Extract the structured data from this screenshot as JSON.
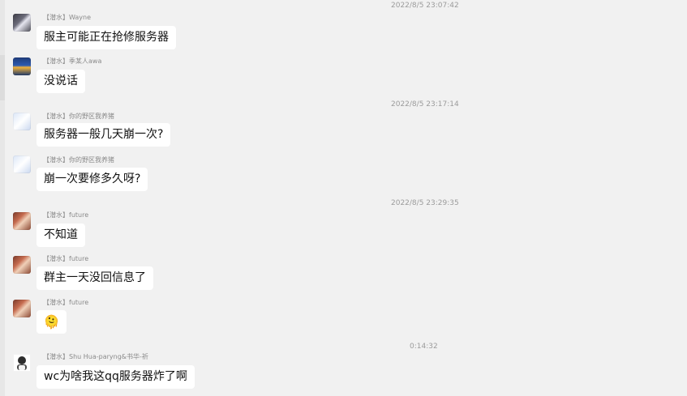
{
  "timestamps": [
    "2022/8/5 23:07:42",
    "2022/8/5 23:17:14",
    "2022/8/5 23:29:35",
    "0:14:32"
  ],
  "messages": [
    {
      "sender": "【潜水】Wayne",
      "text": "服主可能正在抢修服务器",
      "avatar": "avatar-wayne"
    },
    {
      "sender": "【潜水】季某人awa",
      "text": "没说话",
      "avatar": "avatar-ji"
    },
    {
      "sender": "【潜水】你的野区我养猪",
      "text": "服务器一般几天崩一次?",
      "avatar": "avatar-pig"
    },
    {
      "sender": "【潜水】你的野区我养猪",
      "text": "崩一次要修多久呀?",
      "avatar": "avatar-pig"
    },
    {
      "sender": "【潜水】future",
      "text": "不知道",
      "avatar": "avatar-future"
    },
    {
      "sender": "【潜水】future",
      "text": "群主一天没回信息了",
      "avatar": "avatar-future"
    },
    {
      "sender": "【潜水】future",
      "text": "🫠",
      "avatar": "avatar-future",
      "emoji_name": "face-emoji"
    },
    {
      "sender": "【潜水】Shu Hua-paryng&书华-祈",
      "text": "wc为啥我这qq服务器炸了啊",
      "avatar": "avatar-shu"
    }
  ]
}
